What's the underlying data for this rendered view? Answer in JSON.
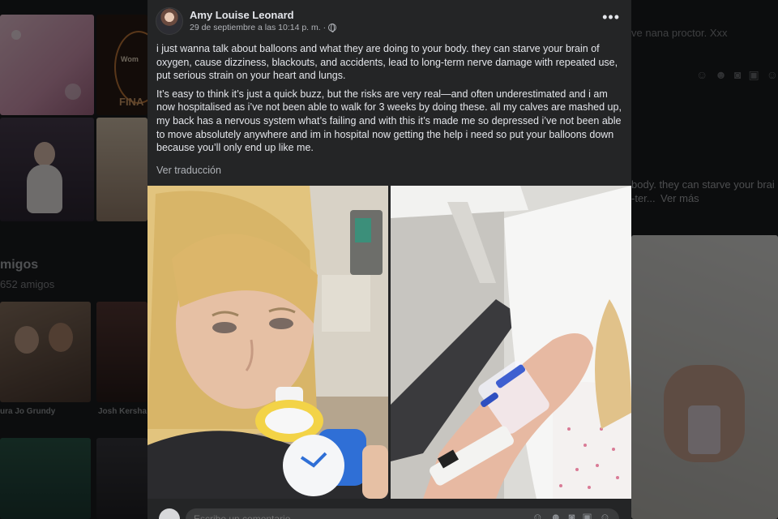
{
  "post": {
    "author": "Amy Louise Leonard",
    "timestamp": "29 de septiembre a las 10:14 p. m. ·",
    "more_label": "•••",
    "paragraphs": [
      "i just wanna talk about balloons and what they are doing to your body. they can starve your brain of oxygen, cause dizziness, blackouts, and accidents, lead to long-term nerve damage with repeated use, put serious strain on your heart and lungs.",
      "It’s easy to think it’s just a quick buzz, but the risks are very real—and often underestimated and i am now hospitalised as i’ve not been able to walk for 3 weeks by doing these. all my calves are mashed up, my back has a nervous system what’s failing and with this it’s made me so depressed i’ve not been able to move absolutely anywhere and im in hospital now getting the help i need so put your balloons down because you’ll only end up like me."
    ],
    "see_translation": "Ver traducción",
    "comment_placeholder": "Escribe un comentario..."
  },
  "background": {
    "friends_heading": "migos",
    "friends_count": "652 amigos",
    "friend_names": [
      "ura Jo Grundy",
      "Josh Kersha"
    ],
    "right_comment_snippet": "ve nana proctor. Xxx",
    "right_post_snippet_1": "body. they can starve your brai",
    "right_post_snippet_2": "-ter...",
    "right_see_more": "Ver más",
    "tile_text_1": "Wom",
    "tile_text_2": "FINA"
  },
  "icons": {
    "globe": "globe-icon",
    "more": "more-options-icon",
    "comment_tools": [
      "emoji-icon",
      "sticker-icon",
      "camera-icon",
      "gif-icon",
      "avatar-sticker-icon"
    ]
  },
  "colors": {
    "post_bg": "#242526",
    "primary_text": "#e4e6eb",
    "secondary_text": "#b0b3b8",
    "backdrop": "#18191a"
  }
}
